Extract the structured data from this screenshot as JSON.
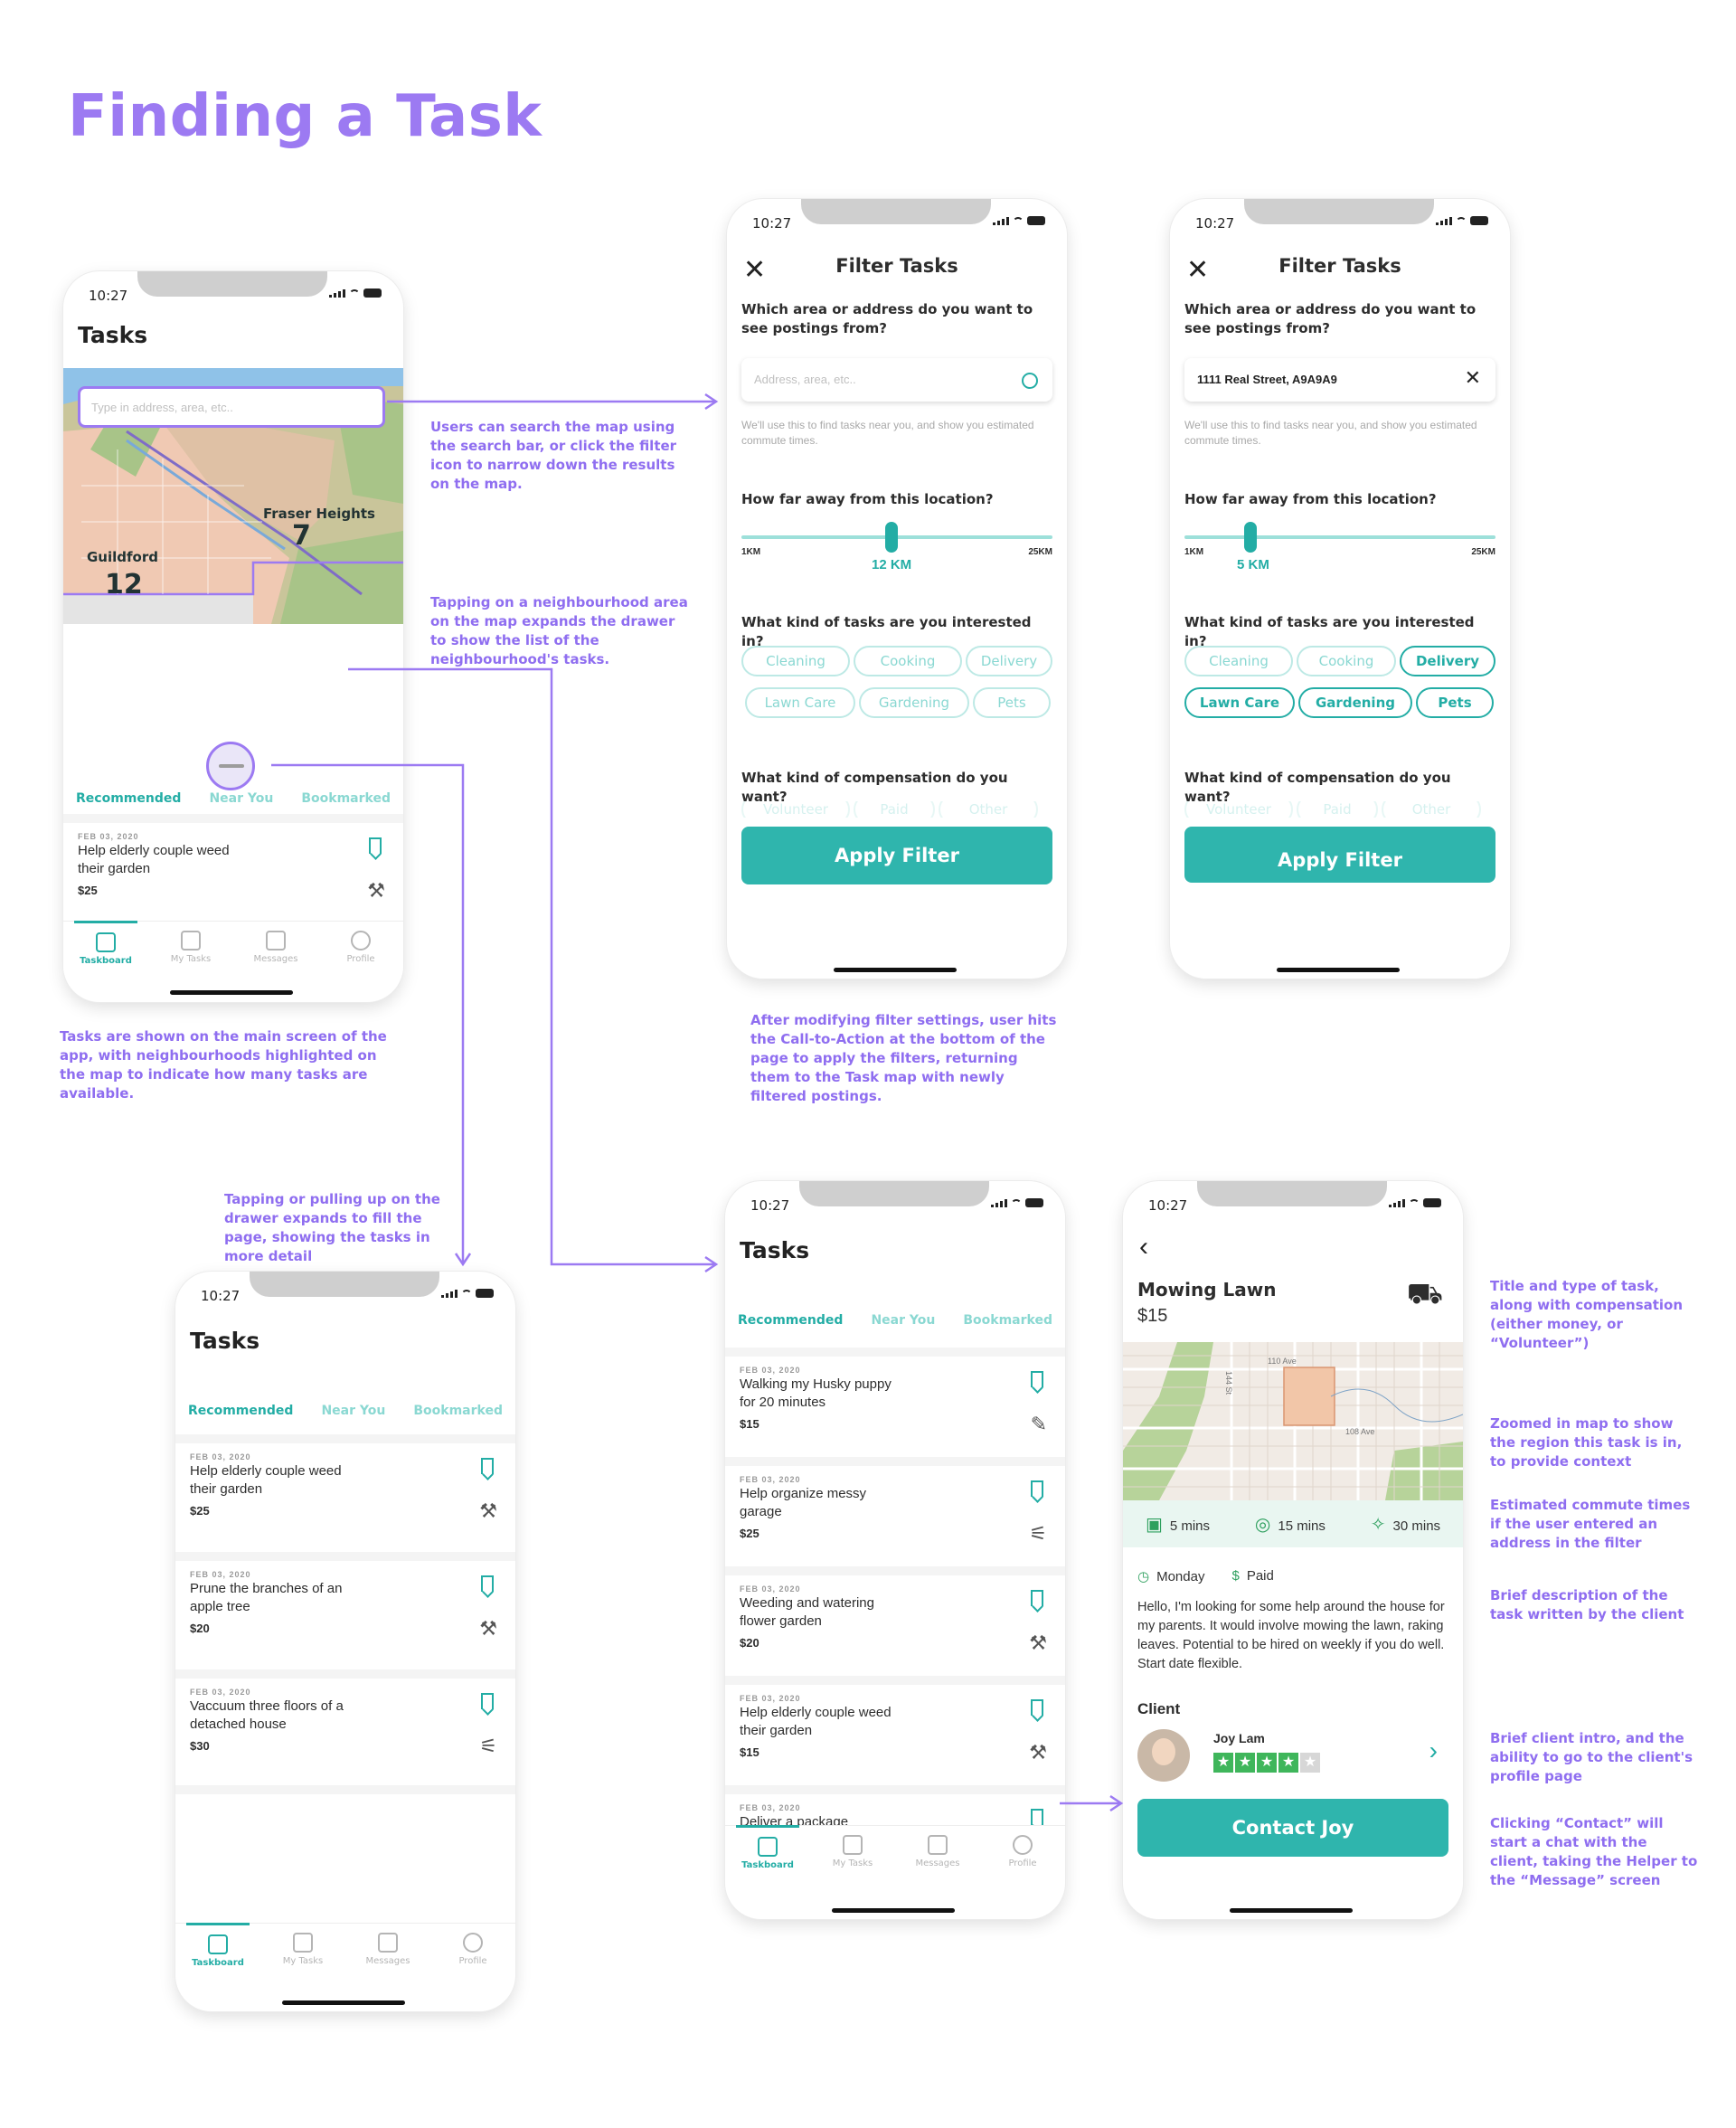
{
  "page": {
    "title": "Finding a Task"
  },
  "status": {
    "time": "10:27"
  },
  "nav": {
    "taskboard": "Taskboard",
    "my_tasks": "My Tasks",
    "messages": "Messages",
    "profile": "Profile"
  },
  "tabs": {
    "recommended": "Recommended",
    "near_you": "Near You",
    "bookmarked": "Bookmarked"
  },
  "screen1": {
    "title": "Tasks",
    "search_placeholder": "Type in address, area, etc..",
    "neighbourhoods": [
      {
        "name": "Fraser Heights",
        "count": "7"
      },
      {
        "name": "Guildford",
        "count": "12"
      }
    ],
    "card": {
      "date": "FEB 03, 2020",
      "title": "Help elderly couple weed their garden",
      "price": "$25"
    }
  },
  "filter": {
    "title": "Filter Tasks",
    "q_area": "Which area or address do you want to see postings from?",
    "address_placeholder": "Address, area, etc..",
    "address_value": "1111 Real Street, A9A9A9",
    "hint": "We'll use this to find tasks near you, and show you estimated commute times.",
    "q_distance": "How far away from this location?",
    "min_label": "1KM",
    "max_label": "25KM",
    "distance_a": "12 KM",
    "distance_b": "5 KM",
    "q_kind": "What kind of tasks are you interested in?",
    "chips": [
      "Cleaning",
      "Cooking",
      "Delivery",
      "Lawn Care",
      "Gardening",
      "Pets"
    ],
    "chips_selected_b": [
      "Delivery",
      "Lawn Care",
      "Gardening",
      "Pets"
    ],
    "q_comp": "What kind of compensation do you want?",
    "comp_options": [
      "Volunteer",
      "Paid",
      "Other"
    ],
    "apply": "Apply Filter"
  },
  "screen_drawer": {
    "title": "Tasks",
    "cards": [
      {
        "date": "FEB 03, 2020",
        "title": "Help elderly couple weed their garden",
        "price": "$25"
      },
      {
        "date": "FEB 03, 2020",
        "title": "Prune the branches of an apple tree",
        "price": "$20"
      },
      {
        "date": "FEB 03, 2020",
        "title": "Vaccuum three floors of a detached house",
        "price": "$30"
      }
    ]
  },
  "screen_list": {
    "title": "Tasks",
    "cards": [
      {
        "date": "FEB 03, 2020",
        "title": "Walking my Husky puppy for 20 minutes",
        "price": "$15"
      },
      {
        "date": "FEB 03, 2020",
        "title": "Help organize messy garage",
        "price": "$25"
      },
      {
        "date": "FEB 03, 2020",
        "title": "Weeding and watering flower garden",
        "price": "$20"
      },
      {
        "date": "FEB 03, 2020",
        "title": "Help elderly couple weed their garden",
        "price": "$15"
      },
      {
        "date": "FEB 03, 2020",
        "title": "Deliver a package",
        "price": ""
      }
    ]
  },
  "detail": {
    "title": "Mowing Lawn",
    "price": "$15",
    "street_a": "110 Ave",
    "street_b": "108 Ave",
    "street_c": "144 St",
    "commute": {
      "bus": "5 mins",
      "bike": "15 mins",
      "walk": "30 mins"
    },
    "day": "Monday",
    "comp": "Paid",
    "description": "Hello, I'm looking for some help around the house for my parents. It would involve mowing the lawn, raking leaves. Potential to be hired on weekly if you do well. Start date flexible.",
    "client_heading": "Client",
    "client_name": "Joy Lam",
    "rating": 4,
    "contact": "Contact Joy"
  },
  "notes": {
    "search": "Users can search the map using the search bar, or click the filter icon to narrow down the results on the map.",
    "neighbourhood": "Tapping on a neighbourhood area on the map expands the drawer to show the list of the neighbourhood's tasks.",
    "main": "Tasks are shown on the main screen of the app, with neighbourhoods highlighted on the map to indicate how many tasks are available.",
    "apply": "After modifying filter settings, user hits the Call-to-Action at the bottom of the page to apply the filters, returning them to the Task map with newly filtered postings.",
    "drawer": "Tapping or pulling up on the drawer expands to fill the page, showing the tasks in more detail",
    "title_type": "Title and type of task, along with compensation (either money, or “Volunteer”)",
    "zoom": "Zoomed in map to show the region this task is in, to provide context",
    "commute": "Estimated commute times if the user entered an address in the filter",
    "brief": "Brief description of the task written by the client",
    "client": "Brief client intro, and the ability to go to the client's profile page",
    "contact": "Clicking “Contact” will start a chat with the client, taking the Helper to the “Message” screen"
  },
  "colors": {
    "accent": "#9c7af2",
    "teal": "#23ada5",
    "button": "#2fb5ad"
  }
}
